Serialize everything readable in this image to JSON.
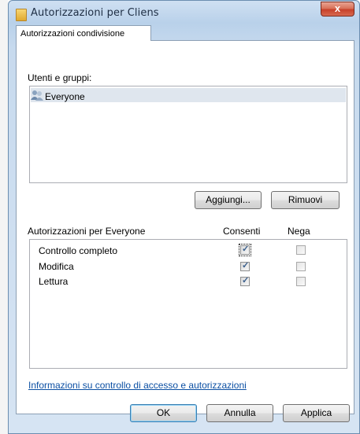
{
  "window": {
    "title": "Autorizzazioni per Cliens",
    "close_label": "x"
  },
  "tab": {
    "label": "Autorizzazioni condivisione"
  },
  "users": {
    "label": "Utenti e gruppi:",
    "items": [
      {
        "name": "Everyone",
        "icon": "users-group-icon",
        "selected": true
      }
    ]
  },
  "user_buttons": {
    "add": "Aggiungi...",
    "remove": "Rimuovi"
  },
  "permissions": {
    "label": "Autorizzazioni per Everyone",
    "allow_header": "Consenti",
    "deny_header": "Nega",
    "rows": [
      {
        "name": "Controllo completo",
        "allow": true,
        "deny": false
      },
      {
        "name": "Modifica",
        "allow": true,
        "deny": false
      },
      {
        "name": "Lettura",
        "allow": true,
        "deny": false
      }
    ]
  },
  "info_link": "Informazioni su controllo di accesso e autorizzazioni",
  "footer": {
    "ok": "OK",
    "cancel": "Annulla",
    "apply": "Applica"
  },
  "colors": {
    "accent": "#0b4fa3",
    "close": "#c7412a",
    "title_gradient": "#b9d1ea"
  }
}
